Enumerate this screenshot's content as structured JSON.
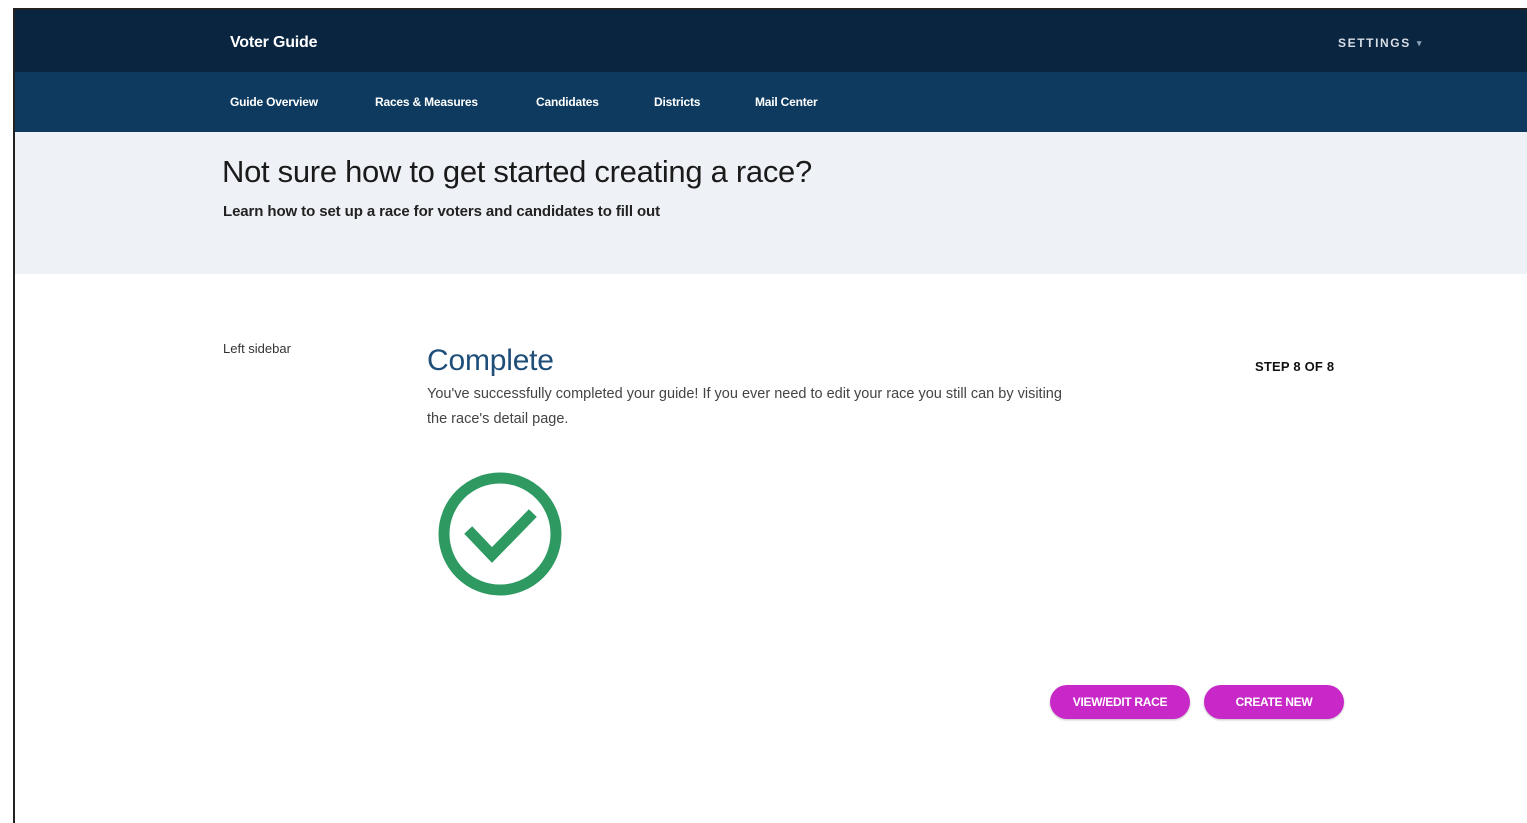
{
  "header": {
    "brand": "Voter Guide",
    "settings_label": "SETTINGS",
    "settings_caret": "▾"
  },
  "nav": {
    "items": [
      {
        "label": "Guide Overview"
      },
      {
        "label": "Races & Measures"
      },
      {
        "label": "Candidates"
      },
      {
        "label": "Districts"
      },
      {
        "label": "Mail Center"
      }
    ]
  },
  "hero": {
    "title": "Not sure how to get started creating a race?",
    "subtitle": "Learn how to set up a race for voters and candidates to fill out"
  },
  "sidebar": {
    "label": "Left sidebar"
  },
  "step": {
    "title": "Complete",
    "counter": "STEP 8 OF 8",
    "description": "You've successfully completed your guide! If you ever need to edit your race you still can by visiting the race's detail page.",
    "icon": "check-circle-icon"
  },
  "actions": {
    "view_edit_label": "VIEW/EDIT RACE",
    "create_new_label": "CREATE NEW"
  },
  "colors": {
    "topbar": "#0a2540",
    "subnav": "#0d3a5e",
    "hero_bg": "#eef2f6",
    "accent_title": "#1f4e79",
    "success": "#2e9a62",
    "button": "#c728c7"
  }
}
